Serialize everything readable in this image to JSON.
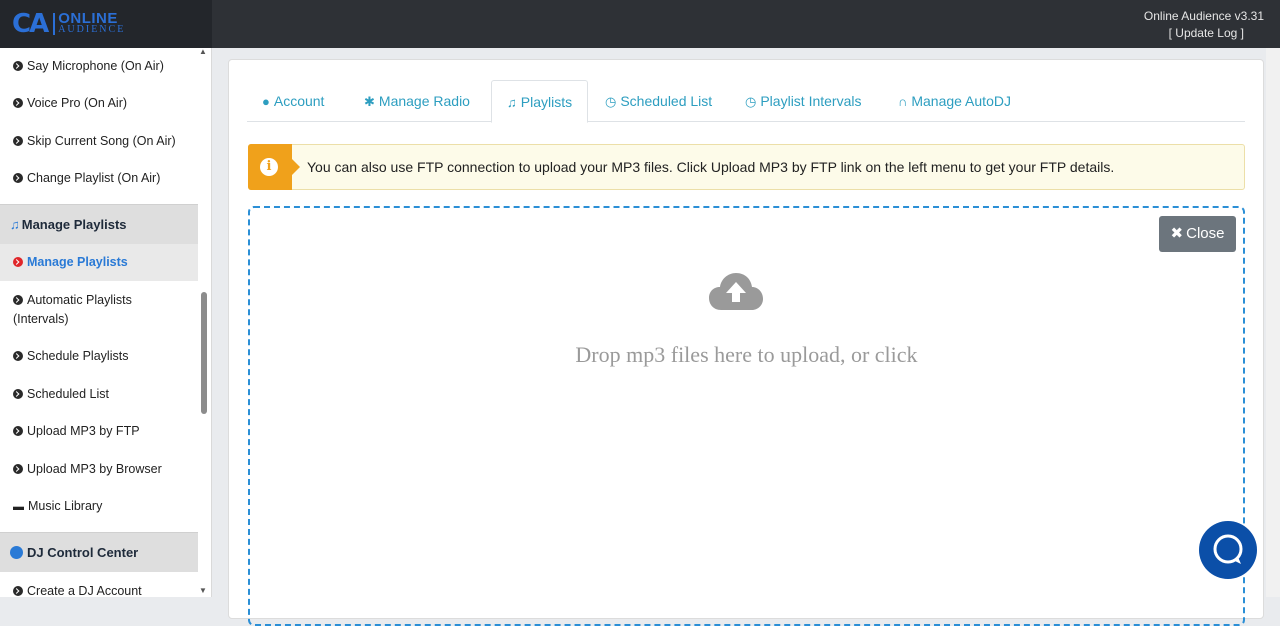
{
  "header": {
    "logo_mark": "CA",
    "logo_line1": "ONLINE",
    "logo_line2": "AUDIENCE",
    "version": "Online Audience v3.31",
    "update_log": "[ Update Log ]"
  },
  "sidebar": {
    "items_top": [
      {
        "label": "Say Microphone (On Air)"
      },
      {
        "label": "Voice Pro (On Air)"
      },
      {
        "label": "Skip Current Song (On Air)"
      },
      {
        "label": "Change Playlist (On Air)"
      }
    ],
    "section_playlists": "Manage Playlists",
    "items_playlists": [
      {
        "label": "Manage Playlists"
      },
      {
        "label": "Automatic Playlists (Intervals)"
      },
      {
        "label": "Schedule Playlists"
      },
      {
        "label": "Scheduled List"
      },
      {
        "label": "Upload MP3 by FTP"
      },
      {
        "label": "Upload MP3 by Browser"
      },
      {
        "label": "Music Library"
      }
    ],
    "section_dj": "DJ Control Center",
    "items_dj": [
      {
        "label": "Create a DJ Account"
      }
    ]
  },
  "tabs": [
    {
      "label": "Account",
      "icon": "user-circle-icon"
    },
    {
      "label": "Manage Radio",
      "icon": "gear-icon"
    },
    {
      "label": "Playlists",
      "icon": "music-note-icon",
      "active": true
    },
    {
      "label": "Scheduled List",
      "icon": "clock-icon"
    },
    {
      "label": "Playlist Intervals",
      "icon": "clock-icon"
    },
    {
      "label": "Manage AutoDJ",
      "icon": "headphones-icon"
    }
  ],
  "alert": {
    "icon": "info-icon",
    "text": "You can also use FTP connection to upload your MP3 files. Click Upload MP3 by FTP link on the left menu to get your FTP details."
  },
  "dropzone": {
    "close_label": "Close",
    "message": "Drop mp3 files here to upload, or click",
    "icon": "cloud-upload-icon"
  },
  "colors": {
    "accent": "#2d9ec0",
    "header_bg": "#2e3136",
    "warning": "#f0a11b",
    "drop_border": "#2b8fd6",
    "chat_button": "#0b4fa8"
  }
}
